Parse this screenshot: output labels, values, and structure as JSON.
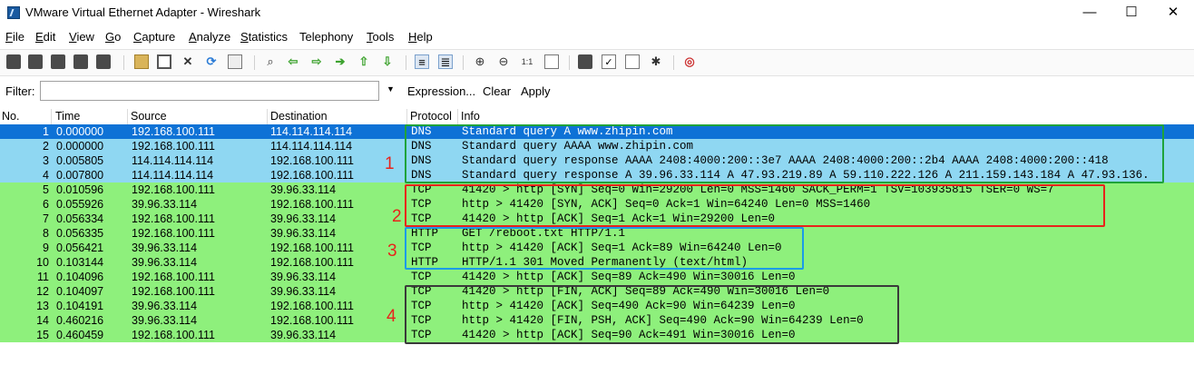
{
  "window": {
    "title": "VMware Virtual Ethernet Adapter - Wireshark",
    "minimize_glyph": "—",
    "maximize_glyph": "☐",
    "close_glyph": "✕"
  },
  "menu": [
    {
      "label": "File",
      "accel": "F",
      "rest": "ile"
    },
    {
      "label": "Edit",
      "accel": "E",
      "rest": "dit"
    },
    {
      "label": "View",
      "accel": "V",
      "rest": "iew"
    },
    {
      "label": "Go",
      "accel": "G",
      "rest": "o"
    },
    {
      "label": "Capture",
      "accel": "C",
      "rest": "apture"
    },
    {
      "label": "Analyze",
      "accel": "A",
      "rest": "nalyze"
    },
    {
      "label": "Statistics",
      "accel": "S",
      "rest": "tatistics"
    },
    {
      "label": "Telephony",
      "accel": "",
      "rest": "Telephony"
    },
    {
      "label": "Tools",
      "accel": "T",
      "rest": "ools"
    },
    {
      "label": "Help",
      "accel": "H",
      "rest": "elp"
    }
  ],
  "toolbar_icons": [
    "interface-list-icon",
    "capture-options-icon",
    "start-capture-icon",
    "stop-capture-icon",
    "restart-capture-icon",
    "open-file-icon",
    "save-file-icon",
    "close-file-icon",
    "reload-icon",
    "print-icon",
    "find-packet-icon",
    "go-back-icon",
    "go-forward-icon",
    "go-to-packet-icon",
    "go-first-icon",
    "go-last-icon",
    "colorize-icon",
    "auto-scroll-icon",
    "zoom-in-icon",
    "zoom-out-icon",
    "normal-size-icon",
    "resize-columns-icon",
    "capture-filters-icon",
    "display-filters-icon",
    "coloring-rules-icon",
    "preferences-icon",
    "help-icon"
  ],
  "filter": {
    "label": "Filter:",
    "value": "",
    "placeholder": "",
    "expression_label": "Expression...",
    "clear_label": "Clear",
    "apply_label": "Apply"
  },
  "columns": {
    "no": "No.",
    "time": "Time",
    "source": "Source",
    "destination": "Destination",
    "protocol": "Protocol",
    "info": "Info"
  },
  "packets": [
    {
      "no": "1",
      "time": "0.000000",
      "src": "192.168.100.111",
      "dst": "114.114.114.114",
      "proto": "DNS",
      "info": "Standard query A www.zhipin.com",
      "selected": true
    },
    {
      "no": "2",
      "time": "0.000000",
      "src": "192.168.100.111",
      "dst": "114.114.114.114",
      "proto": "DNS",
      "info": "Standard query AAAA www.zhipin.com"
    },
    {
      "no": "3",
      "time": "0.005805",
      "src": "114.114.114.114",
      "dst": "192.168.100.111",
      "proto": "DNS",
      "info": "Standard query response AAAA 2408:4000:200::3e7 AAAA 2408:4000:200::2b4 AAAA 2408:4000:200::418"
    },
    {
      "no": "4",
      "time": "0.007800",
      "src": "114.114.114.114",
      "dst": "192.168.100.111",
      "proto": "DNS",
      "info": "Standard query response A 39.96.33.114 A 47.93.219.89 A 59.110.222.126 A 211.159.143.184 A 47.93.136."
    },
    {
      "no": "5",
      "time": "0.010596",
      "src": "192.168.100.111",
      "dst": "39.96.33.114",
      "proto": "TCP",
      "info": "41420 > http [SYN] Seq=0 Win=29200 Len=0 MSS=1460 SACK_PERM=1 TSV=103935815 TSER=0 WS=7"
    },
    {
      "no": "6",
      "time": "0.055926",
      "src": "39.96.33.114",
      "dst": "192.168.100.111",
      "proto": "TCP",
      "info": "http > 41420 [SYN, ACK] Seq=0 Ack=1 Win=64240 Len=0 MSS=1460"
    },
    {
      "no": "7",
      "time": "0.056334",
      "src": "192.168.100.111",
      "dst": "39.96.33.114",
      "proto": "TCP",
      "info": "41420 > http [ACK] Seq=1 Ack=1 Win=29200 Len=0"
    },
    {
      "no": "8",
      "time": "0.056335",
      "src": "192.168.100.111",
      "dst": "39.96.33.114",
      "proto": "HTTP",
      "info": "GET /reboot.txt HTTP/1.1"
    },
    {
      "no": "9",
      "time": "0.056421",
      "src": "39.96.33.114",
      "dst": "192.168.100.111",
      "proto": "TCP",
      "info": "http > 41420 [ACK] Seq=1 Ack=89 Win=64240 Len=0"
    },
    {
      "no": "10",
      "time": "0.103144",
      "src": "39.96.33.114",
      "dst": "192.168.100.111",
      "proto": "HTTP",
      "info": "HTTP/1.1 301 Moved Permanently  (text/html)"
    },
    {
      "no": "11",
      "time": "0.104096",
      "src": "192.168.100.111",
      "dst": "39.96.33.114",
      "proto": "TCP",
      "info": "41420 > http [ACK] Seq=89 Ack=490 Win=30016 Len=0"
    },
    {
      "no": "12",
      "time": "0.104097",
      "src": "192.168.100.111",
      "dst": "39.96.33.114",
      "proto": "TCP",
      "info": "41420 > http [FIN, ACK] Seq=89 Ack=490 Win=30016 Len=0"
    },
    {
      "no": "13",
      "time": "0.104191",
      "src": "39.96.33.114",
      "dst": "192.168.100.111",
      "proto": "TCP",
      "info": "http > 41420 [ACK] Seq=490 Ack=90 Win=64239 Len=0"
    },
    {
      "no": "14",
      "time": "0.460216",
      "src": "39.96.33.114",
      "dst": "192.168.100.111",
      "proto": "TCP",
      "info": "http > 41420 [FIN, PSH, ACK] Seq=490 Ack=90 Win=64239 Len=0"
    },
    {
      "no": "15",
      "time": "0.460459",
      "src": "192.168.100.111",
      "dst": "39.96.33.114",
      "proto": "TCP",
      "info": "41420 > http [ACK] Seq=90 Ack=491 Win=30016 Len=0"
    }
  ],
  "annotations": [
    {
      "label": "1",
      "color": "#1fa33a"
    },
    {
      "label": "2",
      "color": "#e8231b"
    },
    {
      "label": "3",
      "color": "#1b9be8"
    },
    {
      "label": "4",
      "color": "#3a3a3a"
    }
  ],
  "colors": {
    "dns_row": "#8fd7f2",
    "tcp_row": "#8ef07c",
    "selected_row": "#0e72d6"
  }
}
